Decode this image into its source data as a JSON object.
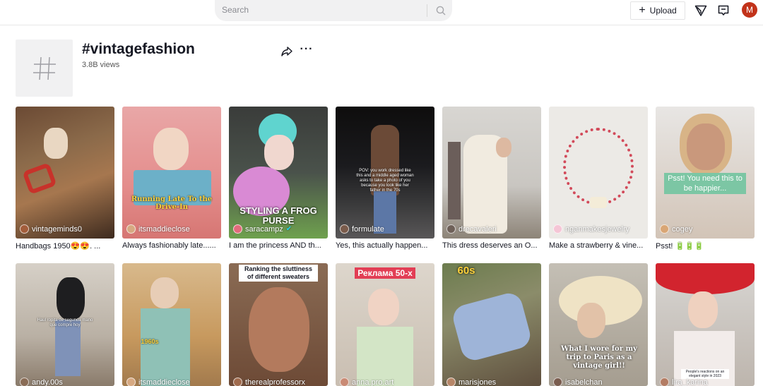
{
  "search": {
    "placeholder": "Search"
  },
  "toolbar": {
    "upload_label": "Upload",
    "avatar_letter": "M"
  },
  "hashtag": {
    "title": "#vintagefashion",
    "views": "3.8B views"
  },
  "videos_row1": [
    {
      "author": "vintageminds0",
      "caption": "Handbags 1950😍😍. ...",
      "overlay": ""
    },
    {
      "author": "itsmaddieclose",
      "caption": "Always fashionably late......",
      "overlay": "Running Late To the Drive-In"
    },
    {
      "author": "saracampz",
      "caption": "I am the princess AND th...",
      "overlay": "STYLING A FROG PURSE"
    },
    {
      "author": "formulate",
      "caption": "Yes, this actually happen...",
      "overlay": "POV: you work dressed like this and a middle aged woman asks to take a photo of you because you look like her father in the 70s"
    },
    {
      "author": "drecavaleri",
      "caption": "This dress deserves an O...",
      "overlay": ""
    },
    {
      "author": "nganmakesjewelry",
      "caption": "Make a strawberry & vine...",
      "overlay": ""
    },
    {
      "author": "cogey",
      "caption": "Psst! 🔋🔋🔋",
      "overlay": "Psst! You need this to be happier..."
    }
  ],
  "videos_row2": [
    {
      "author": "andy.00s",
      "overlay": "Haul ropita de segunda mano que compre hoy"
    },
    {
      "author": "itsmaddieclose",
      "overlay": "1960s"
    },
    {
      "author": "therealprofessorx",
      "overlay": "Ranking the sluttiness of different sweaters"
    },
    {
      "author": "anna.pro.art",
      "overlay": "Реклама 50-х"
    },
    {
      "author": "marisjones",
      "overlay": "60s"
    },
    {
      "author": "isabelchan",
      "overlay": "What I wore for my trip to Paris as a vintage girl!!"
    },
    {
      "author": "lira_karina",
      "overlay": "People's reactions on an elegant style in 2023"
    }
  ]
}
